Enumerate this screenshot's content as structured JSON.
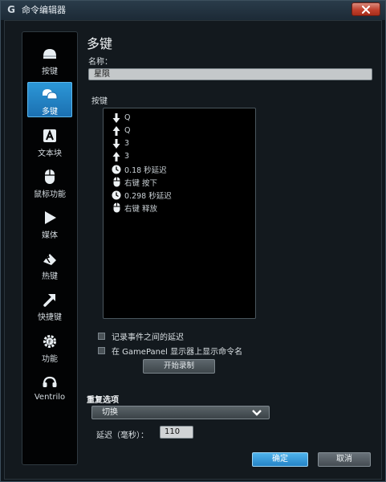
{
  "window": {
    "title": "命令编辑器",
    "logo_glyph": "G",
    "close_icon": "close-icon"
  },
  "sidebar": {
    "items": [
      {
        "label": "按键",
        "icon": "key-icon"
      },
      {
        "label": "多键",
        "icon": "multikey-icon"
      },
      {
        "label": "文本块",
        "icon": "text-block-icon"
      },
      {
        "label": "鼠标功能",
        "icon": "mouse-icon"
      },
      {
        "label": "媒体",
        "icon": "play-icon"
      },
      {
        "label": "热键",
        "icon": "hotkey-icon"
      },
      {
        "label": "快捷键",
        "icon": "shortcut-arrow-icon"
      },
      {
        "label": "功能",
        "icon": "function-gear-icon"
      },
      {
        "label": "Ventrilo",
        "icon": "headset-icon"
      }
    ],
    "active_index": 1
  },
  "main": {
    "title": "多键",
    "name_label": "名称：",
    "name_value": "星陨",
    "keys_label": "按键",
    "key_events": [
      {
        "icon": "arrow-down-icon",
        "text": "Q"
      },
      {
        "icon": "arrow-up-icon",
        "text": "Q"
      },
      {
        "icon": "arrow-down-icon",
        "text": "3"
      },
      {
        "icon": "arrow-up-icon",
        "text": "3"
      },
      {
        "icon": "clock-icon",
        "text": "0.18 秒延迟"
      },
      {
        "icon": "mouse-icon",
        "text": "右键 按下"
      },
      {
        "icon": "clock-icon",
        "text": "0.298 秒延迟"
      },
      {
        "icon": "mouse-icon",
        "text": "右键 释放"
      }
    ],
    "check_record_delay": "记录事件之间的延迟",
    "check_gamepanel": "在 GamePanel 显示器上显示命令名",
    "record_button": "开始录制",
    "repeat_label": "重复选项",
    "repeat_value": "切换",
    "delay_label": "延迟（毫秒）：",
    "delay_value": "110",
    "ok_button": "确定",
    "cancel_button": "取消"
  },
  "colors": {
    "accent": "#2a8fd2",
    "background": "#13191e",
    "list_background": "#000000"
  }
}
